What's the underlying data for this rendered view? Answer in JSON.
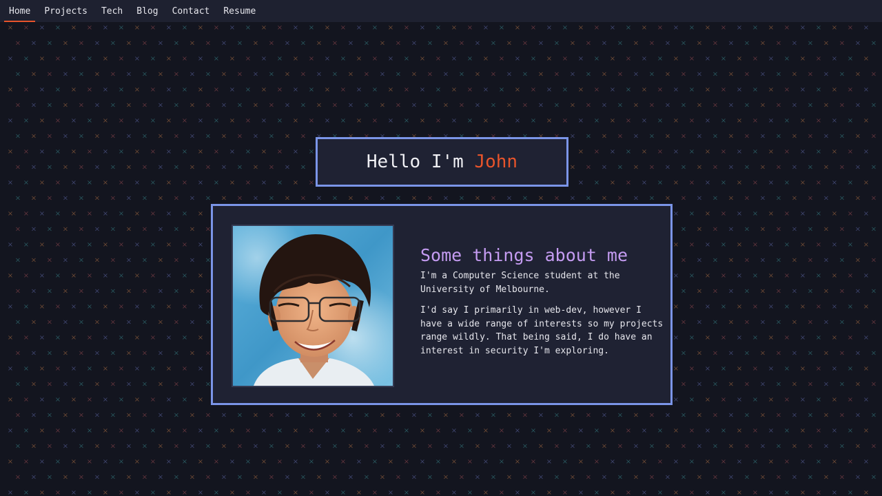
{
  "nav": {
    "items": [
      {
        "label": "Home",
        "active": true
      },
      {
        "label": "Projects",
        "active": false
      },
      {
        "label": "Tech",
        "active": false
      },
      {
        "label": "Blog",
        "active": false
      },
      {
        "label": "Contact",
        "active": false
      },
      {
        "label": "Resume",
        "active": false
      }
    ]
  },
  "hero": {
    "greeting": "Hello I'm ",
    "name": "John"
  },
  "about": {
    "heading": "Some things about me",
    "paragraphs": [
      "I'm a Computer Science student at the University of Melbourne.",
      "I'd say I primarily in web-dev, however I have a wide range of interests so my projects range wildly. That being said, I do have an interest in security I'm exploring."
    ],
    "photo_icon": "profile-photo"
  },
  "background": {
    "pattern_glyph": "×",
    "colors": [
      "#8a5b3b",
      "#2f6b72",
      "#4d5588",
      "#7a3f46"
    ]
  },
  "colors": {
    "accent": "#e8542b",
    "heading": "#c59cf2",
    "border": "#7b95e8",
    "panel": "#1f2233",
    "page": "#13151f",
    "navbar": "#1e2130"
  }
}
